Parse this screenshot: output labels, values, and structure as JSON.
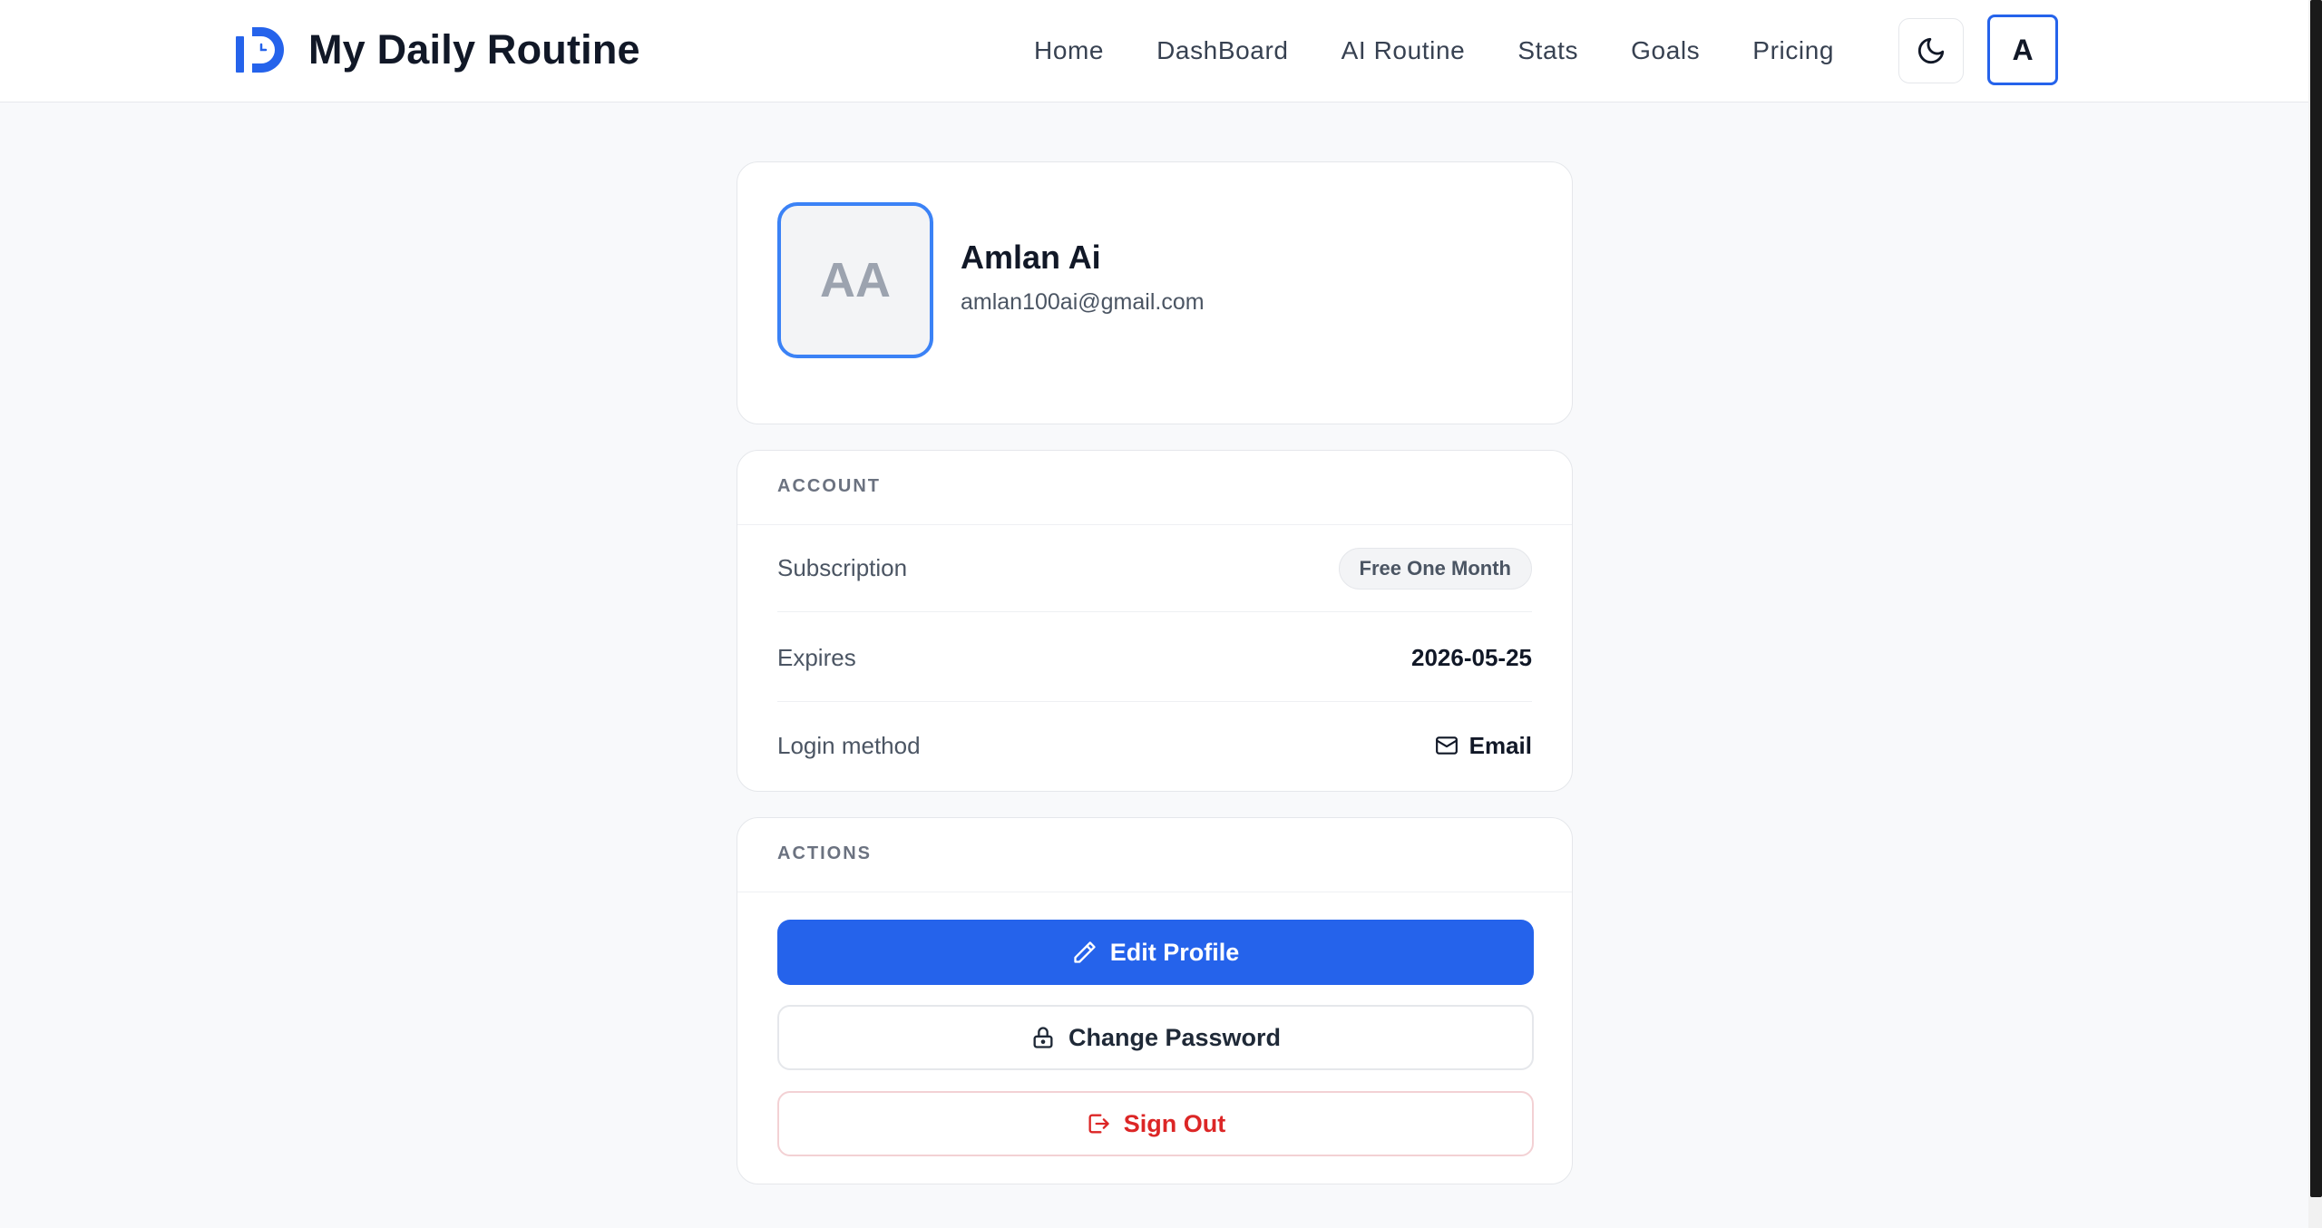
{
  "header": {
    "brand_title": "My Daily Routine",
    "nav": [
      "Home",
      "DashBoard",
      "AI Routine",
      "Stats",
      "Goals",
      "Pricing"
    ],
    "theme_icon": "moon-icon",
    "user_initial": "A"
  },
  "profile": {
    "initials": "AA",
    "name": "Amlan Ai",
    "email": "amlan100ai@gmail.com"
  },
  "account": {
    "section_label": "ACCOUNT",
    "subscription_label": "Subscription",
    "subscription_value": "Free One Month",
    "expires_label": "Expires",
    "expires_value": "2026-05-25",
    "login_label": "Login method",
    "login_value": "Email",
    "login_icon": "mail-icon"
  },
  "actions": {
    "section_label": "ACTIONS",
    "edit_profile": "Edit Profile",
    "change_password": "Change Password",
    "sign_out": "Sign Out"
  },
  "colors": {
    "accent": "#2563eb",
    "danger": "#dc2626",
    "background": "#f8f9fb"
  }
}
